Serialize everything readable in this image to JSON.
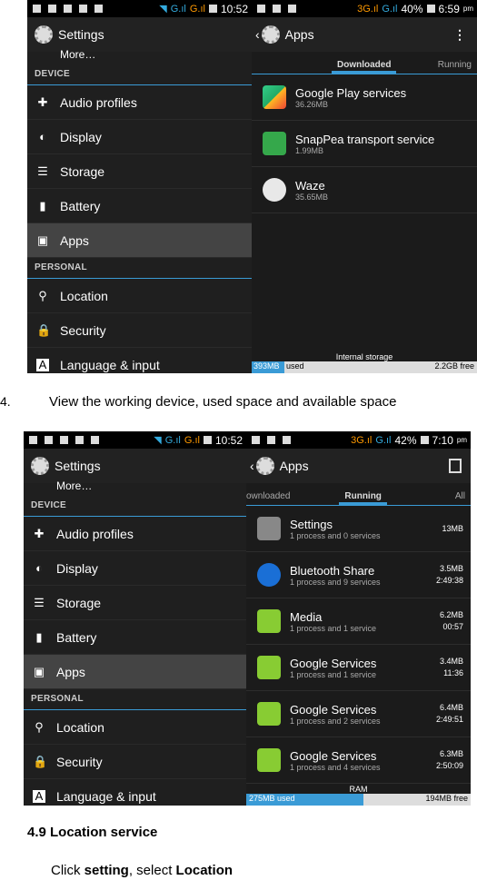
{
  "screenshot1": {
    "status_left_time": "10:52",
    "status_right_battery": "40%",
    "status_right_time": "6:59",
    "status_right_ampm": "pm",
    "settings_title": "Settings",
    "apps_title": "Apps",
    "more_item": "More…",
    "section_device": "DEVICE",
    "section_personal": "PERSONAL",
    "menu": [
      "Audio profiles",
      "Display",
      "Storage",
      "Battery",
      "Apps"
    ],
    "menu2": [
      "Location",
      "Security",
      "Language & input"
    ],
    "tabs": [
      "Downloaded",
      "Running"
    ],
    "apps": [
      {
        "name": "Google Play services",
        "size": "36.26MB",
        "color": "#3a8f3a"
      },
      {
        "name": "SnapPea transport service",
        "size": "1.99MB",
        "color": "#35a84b"
      },
      {
        "name": "Waze",
        "size": "35.65MB",
        "color": "#e8e8e8"
      }
    ],
    "storage_label": "Internal storage",
    "used": "393MB",
    "used_word": "used",
    "free": "2.2GB free",
    "used_fraction": 0.14
  },
  "caption1": {
    "number": "4.",
    "text": "View the working device, used space and available space"
  },
  "screenshot2": {
    "status_left_time": "10:52",
    "status_right_battery": "42%",
    "status_right_time": "7:10",
    "status_right_ampm": "pm",
    "settings_title": "Settings",
    "apps_title": "Apps",
    "more_item": "More…",
    "section_device": "DEVICE",
    "section_personal": "PERSONAL",
    "menu": [
      "Audio profiles",
      "Display",
      "Storage",
      "Battery",
      "Apps"
    ],
    "menu2": [
      "Location",
      "Security",
      "Language & input"
    ],
    "tabs": [
      "ownloaded",
      "Running",
      "All"
    ],
    "apps": [
      {
        "name": "Settings",
        "sub": "1 process and 0 services",
        "size": "13MB",
        "time": ""
      },
      {
        "name": "Bluetooth Share",
        "sub": "1 process and 9 services",
        "size": "3.5MB",
        "time": "2:49:38"
      },
      {
        "name": "Media",
        "sub": "1 process and 1 service",
        "size": "6.2MB",
        "time": "00:57"
      },
      {
        "name": "Google Services",
        "sub": "1 process and 1 service",
        "size": "3.4MB",
        "time": "11:36"
      },
      {
        "name": "Google Services",
        "sub": "1 process and 2 services",
        "size": "6.4MB",
        "time": "2:49:51"
      },
      {
        "name": "Google Services",
        "sub": "1 process and 4 services",
        "size": "6.3MB",
        "time": "2:50:09"
      }
    ],
    "storage_label": "RAM",
    "used": "275MB used",
    "free": "194MB free",
    "used_fraction": 0.55
  },
  "heading": "4.9 Location service",
  "instruction": {
    "click": "Click ",
    "setting": "setting",
    "comma": ", select ",
    "location": "Location"
  }
}
